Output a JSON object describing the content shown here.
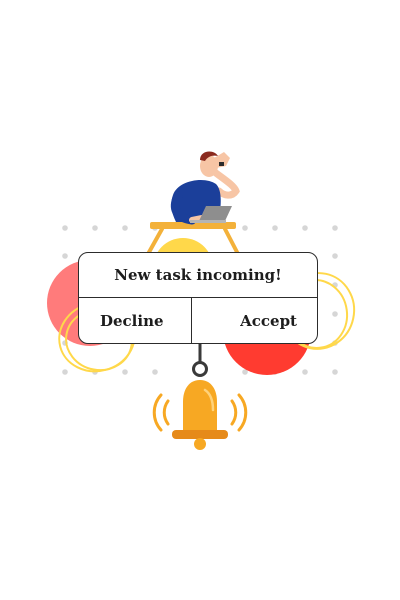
{
  "dialog": {
    "title": "New task incoming!",
    "decline_label": "Decline",
    "accept_label": "Accept"
  },
  "colors": {
    "accent_red": "#ff3b30",
    "coral": "#ff7b7b",
    "yellow": "#ffd84a",
    "bell_orange": "#f7a823",
    "shirt_blue": "#1b3f9a",
    "outline": "#2c2c2c"
  },
  "icons": {
    "bell": "bell-icon",
    "laptop": "laptop-icon"
  }
}
